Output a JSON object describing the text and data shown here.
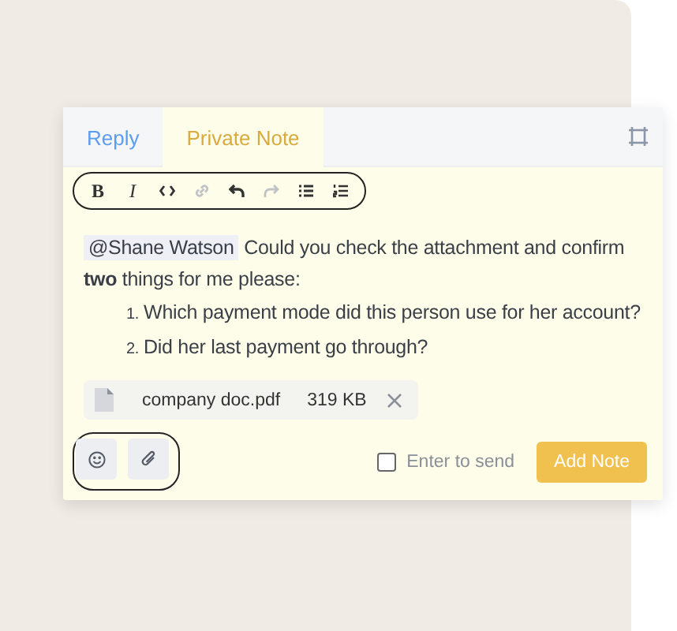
{
  "tabs": [
    {
      "label": "Reply",
      "selected": false
    },
    {
      "label": "Private Note",
      "selected": true
    }
  ],
  "toolbar": [
    {
      "kind": "bold",
      "label": "B",
      "disabled": false
    },
    {
      "kind": "italic",
      "label": "I",
      "disabled": false
    },
    {
      "kind": "code",
      "disabled": false
    },
    {
      "kind": "link",
      "disabled": true
    },
    {
      "kind": "undo",
      "disabled": false
    },
    {
      "kind": "redo",
      "disabled": true
    },
    {
      "kind": "bullets",
      "disabled": false
    },
    {
      "kind": "numbers",
      "disabled": false
    }
  ],
  "message": {
    "mention": "@Shane Watson",
    "text": "Could you check the attachment and confirm **two** things for me please:",
    "list": [
      {
        "number": "1.",
        "text": "Which payment mode did this person use for her account?"
      },
      {
        "number": "2.",
        "text": "Did her last payment go through?"
      }
    ]
  },
  "attachment": {
    "name": "company doc.pdf",
    "size": "319 KB"
  },
  "enter_to_send": {
    "label": "Enter to send",
    "checked": false
  },
  "submit_button": "Add Note"
}
